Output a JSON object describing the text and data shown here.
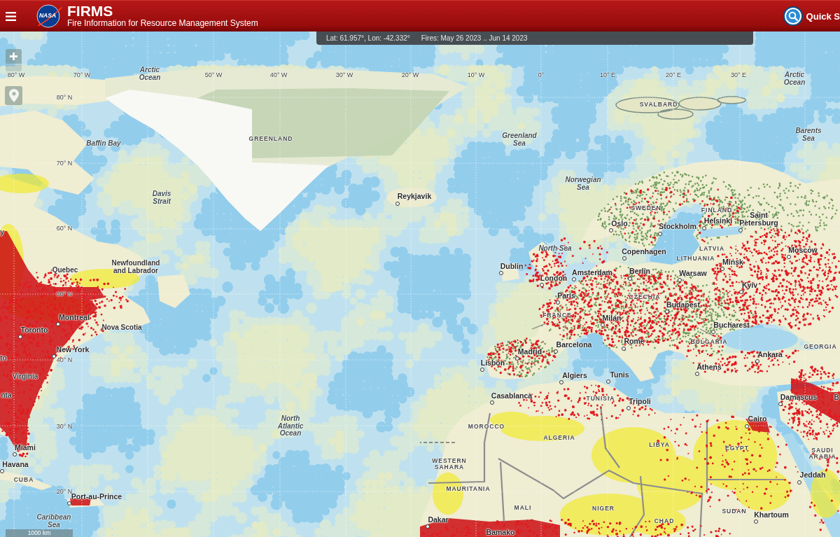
{
  "header": {
    "logo_text": "NASA",
    "title": "FIRMS",
    "subtitle": "Fire Information for Resource Management System",
    "quick_search": "Quick S"
  },
  "info_bar": {
    "coordinates": "Lat: 61.957°, Lon: -42.332°",
    "fire_dates": "Fires: May 26 2023 .. Jun 14 2023"
  },
  "map": {
    "longitude_labels": [
      "80° W",
      "70° W",
      "50° W",
      "40° W",
      "30° W",
      "20° W",
      "10° W",
      "0°",
      "10° E",
      "20° E",
      "30° E"
    ],
    "latitude_labels": [
      "80° N",
      "70° N",
      "60° N",
      "50° N",
      "40° N",
      "30° N",
      "20° N"
    ],
    "place_labels": [
      {
        "kind": "water",
        "text": "Arctic Ocean"
      },
      {
        "kind": "water",
        "text": "Arctic Ocean"
      },
      {
        "kind": "country",
        "text": "SVALBARD"
      },
      {
        "kind": "water",
        "text": "Baffin Bay"
      },
      {
        "kind": "country",
        "text": "GREENLAND"
      },
      {
        "kind": "water",
        "text": "Greenland Sea"
      },
      {
        "kind": "water",
        "text": "Barents Sea"
      },
      {
        "kind": "water",
        "text": "Norwegian Sea"
      },
      {
        "kind": "water",
        "text": "Davis Strait"
      },
      {
        "kind": "city",
        "text": "Reykjavik"
      },
      {
        "kind": "country",
        "text": "SWEDEN"
      },
      {
        "kind": "country",
        "text": "FINLAND"
      },
      {
        "kind": "city",
        "text": "Oslo"
      },
      {
        "kind": "city",
        "text": "Stockholm"
      },
      {
        "kind": "city",
        "text": "Helsinki"
      },
      {
        "kind": "city",
        "text": "Saint Petersburg"
      },
      {
        "kind": "partial",
        "text": "y"
      },
      {
        "kind": "water",
        "text": "North Sea"
      },
      {
        "kind": "city",
        "text": "Copenhagen"
      },
      {
        "kind": "country",
        "text": "LATVIA"
      },
      {
        "kind": "city",
        "text": "Moscow"
      },
      {
        "kind": "country",
        "text": "LITHUANIA"
      },
      {
        "kind": "city",
        "text": "Minsk"
      },
      {
        "kind": "region",
        "text": "Quebec"
      },
      {
        "kind": "region",
        "text": "Newfoundland and Labrador"
      },
      {
        "kind": "city",
        "text": "Dublin"
      },
      {
        "kind": "city",
        "text": "London"
      },
      {
        "kind": "city",
        "text": "Amsterdam"
      },
      {
        "kind": "city",
        "text": "Berlin"
      },
      {
        "kind": "city",
        "text": "Warsaw"
      },
      {
        "kind": "city",
        "text": "Kyiv"
      },
      {
        "kind": "city",
        "text": "Paris"
      },
      {
        "kind": "country",
        "text": "CZECHIA"
      },
      {
        "kind": "city",
        "text": "Budapest"
      },
      {
        "kind": "city",
        "text": "Montreal"
      },
      {
        "kind": "country",
        "text": "FRANCE"
      },
      {
        "kind": "city",
        "text": "Milan"
      },
      {
        "kind": "city",
        "text": "Toronto"
      },
      {
        "kind": "region",
        "text": "Nova Scotia"
      },
      {
        "kind": "city",
        "text": "Bucharest"
      },
      {
        "kind": "city",
        "text": "Barcelona"
      },
      {
        "kind": "city",
        "text": "Rome"
      },
      {
        "kind": "country",
        "text": "BULGARIA"
      },
      {
        "kind": "country",
        "text": "GEORGIA"
      },
      {
        "kind": "city",
        "text": "New York"
      },
      {
        "kind": "city",
        "text": "Madrid"
      },
      {
        "kind": "partial",
        "text": "to"
      },
      {
        "kind": "city",
        "text": "Ankara"
      },
      {
        "kind": "city",
        "text": "Lisbon"
      },
      {
        "kind": "city",
        "text": "Athens"
      },
      {
        "kind": "region",
        "text": "Virginia"
      },
      {
        "kind": "city",
        "text": "Algiers"
      },
      {
        "kind": "city",
        "text": "Tunis"
      },
      {
        "kind": "partial",
        "text": "nta"
      },
      {
        "kind": "city",
        "text": "Casablanca"
      },
      {
        "kind": "country",
        "text": "TUNISIA"
      },
      {
        "kind": "city",
        "text": "Tripoli"
      },
      {
        "kind": "city",
        "text": "Damascus"
      },
      {
        "kind": "partial",
        "text": "B"
      },
      {
        "kind": "water",
        "text": "North Atlantic Ocean"
      },
      {
        "kind": "country",
        "text": "MOROCCO"
      },
      {
        "kind": "city",
        "text": "Cairo"
      },
      {
        "kind": "country",
        "text": "ALGERIA"
      },
      {
        "kind": "city",
        "text": "Miami"
      },
      {
        "kind": "country",
        "text": "LIBYA"
      },
      {
        "kind": "country",
        "text": "EGYPT"
      },
      {
        "kind": "country",
        "text": "SAUDI ARABIA"
      },
      {
        "kind": "city",
        "text": "Havana"
      },
      {
        "kind": "country",
        "text": "WESTERN SAHARA"
      },
      {
        "kind": "city",
        "text": "Jeddah"
      },
      {
        "kind": "country",
        "text": "CUBA"
      },
      {
        "kind": "country",
        "text": "MAURITANIA"
      },
      {
        "kind": "city",
        "text": "Port-au-Prince"
      },
      {
        "kind": "country",
        "text": "MALI"
      },
      {
        "kind": "country",
        "text": "NIGER"
      },
      {
        "kind": "country",
        "text": "SUDAN"
      },
      {
        "kind": "water",
        "text": "Caribbean Sea"
      },
      {
        "kind": "city",
        "text": "Dakar"
      },
      {
        "kind": "country",
        "text": "CHAD"
      },
      {
        "kind": "city",
        "text": "Khartoum"
      },
      {
        "kind": "city",
        "text": "Bamako"
      }
    ],
    "scale_bar": "1000 km"
  }
}
